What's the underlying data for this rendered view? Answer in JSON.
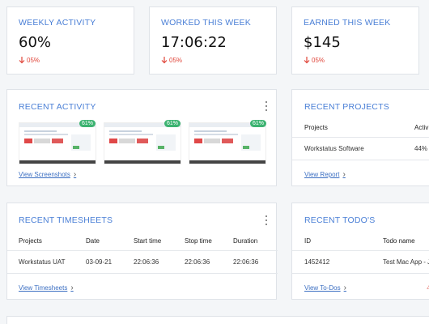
{
  "stats": [
    {
      "title": "WEEKLY ACTIVITY",
      "value": "60%",
      "delta": "05%"
    },
    {
      "title": "WORKED THIS WEEK",
      "value": "17:06:22",
      "delta": "05%"
    },
    {
      "title": "EARNED THIS WEEK",
      "value": "$145",
      "delta": "05%"
    }
  ],
  "recent_activity": {
    "title": "RECENT ACTIVITY",
    "screenshots": [
      {
        "badge": "61%"
      },
      {
        "badge": "61%"
      },
      {
        "badge": "61%"
      }
    ],
    "link": "View Screenshots"
  },
  "recent_projects": {
    "title": "RECENT PROJECTS",
    "headers": [
      "Projects",
      "Activ"
    ],
    "rows": [
      [
        "Workstatus Software",
        "44%"
      ]
    ],
    "link": "View Report"
  },
  "recent_timesheets": {
    "title": "RECENT TIMESHEETS",
    "headers": [
      "Projects",
      "Date",
      "Start time",
      "Stop time",
      "Duration"
    ],
    "rows": [
      [
        "Workstatus UAT",
        "03-09-21",
        "22:06:36",
        "22:06:36",
        "22:06:36"
      ]
    ],
    "link": "View Timesheets"
  },
  "recent_todos": {
    "title": "RECENT TODO'S",
    "headers": [
      "ID",
      "Todo name"
    ],
    "rows": [
      [
        "1452412",
        "Test Mac App - Ja"
      ]
    ],
    "link": "View To-Dos"
  },
  "colors": {
    "accent": "#4a7fd6",
    "link": "#3c6fc2",
    "negative": "#e0453a",
    "badge": "#3cb371"
  }
}
